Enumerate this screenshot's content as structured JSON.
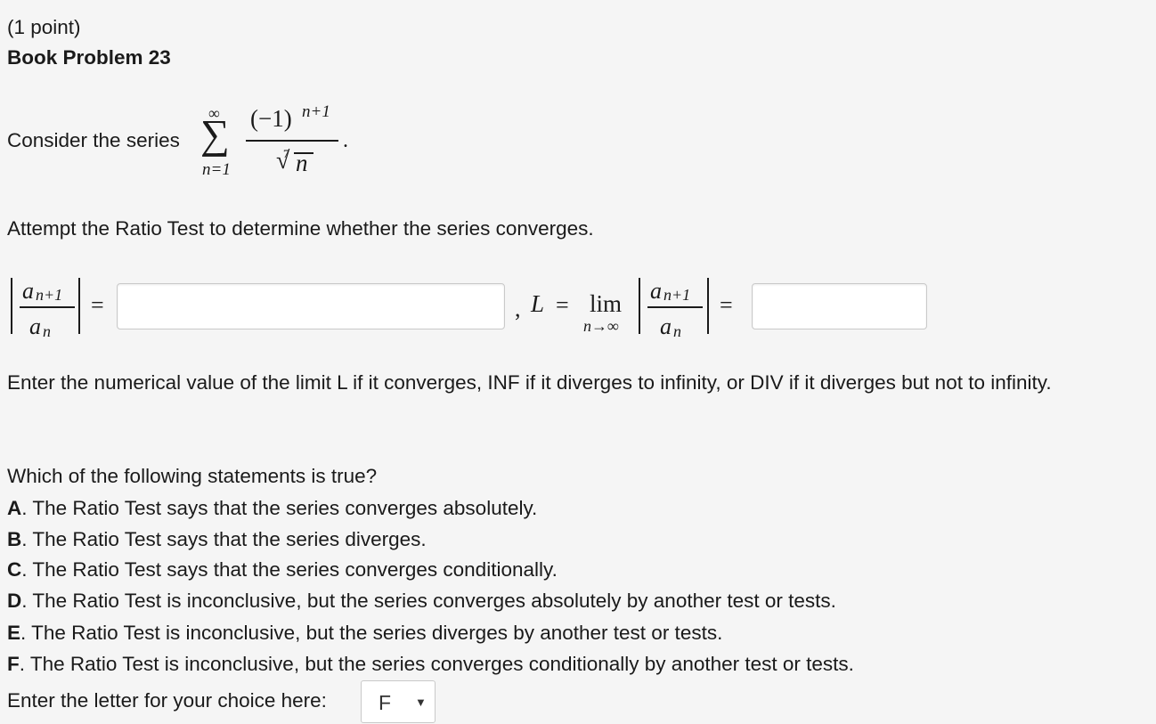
{
  "header": {
    "points": "(1 point)",
    "title": "Book Problem 23"
  },
  "series": {
    "prefix": "Consider the series",
    "sigma": "∑",
    "upper_limit": "∞",
    "lower_limit": "n=1",
    "numerator_base": "(−1)",
    "numerator_exponent": "n+1",
    "root_index": "7",
    "radical": "√",
    "radicand": "n",
    "period": "."
  },
  "instruction": "Attempt the Ratio Test to determine whether the series converges.",
  "ratio": {
    "numerator": "a",
    "numerator_sub": "n+1",
    "denominator": "a",
    "denominator_sub": "n",
    "equals": "=",
    "comma": ",",
    "L": "L",
    "lim": "lim",
    "lim_sub": "n→∞",
    "input1_value": "",
    "input2_value": ""
  },
  "limit_instruction": "Enter the numerical value of the limit L if it converges, INF if it diverges to infinity, or DIV if it diverges but not to infinity.",
  "question": "Which of the following statements is true?",
  "options": [
    {
      "letter": "A",
      "text": ". The Ratio Test says that the series converges absolutely."
    },
    {
      "letter": "B",
      "text": ". The Ratio Test says that the series diverges."
    },
    {
      "letter": "C",
      "text": ". The Ratio Test says that the series converges conditionally."
    },
    {
      "letter": "D",
      "text": ". The Ratio Test is inconclusive, but the series converges absolutely by another test or tests."
    },
    {
      "letter": "E",
      "text": ". The Ratio Test is inconclusive, but the series diverges by another test or tests."
    },
    {
      "letter": "F",
      "text": ". The Ratio Test is inconclusive, but the series converges conditionally by another test or tests."
    }
  ],
  "answer": {
    "prompt": "Enter the letter for your choice here:",
    "selected": "F",
    "arrow": "▼"
  }
}
